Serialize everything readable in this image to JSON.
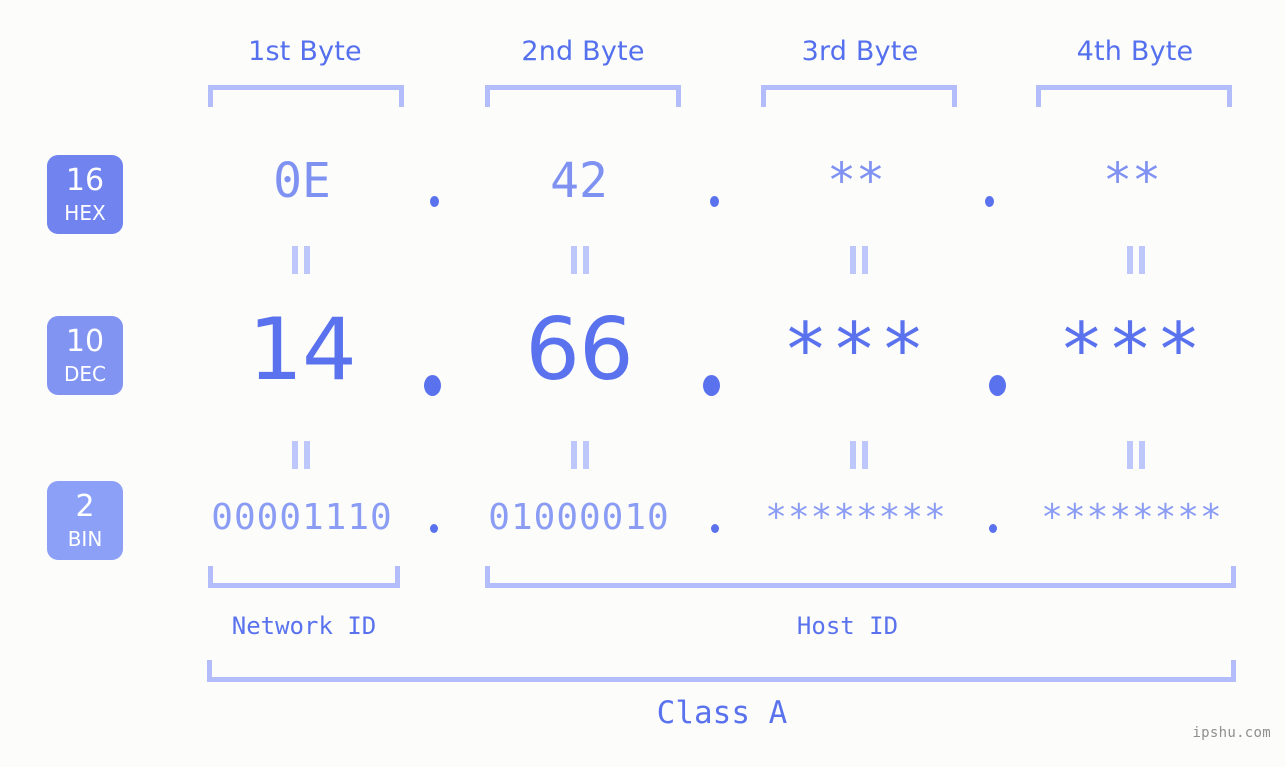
{
  "watermark": "ipshu.com",
  "bytes": [
    {
      "label": "1st Byte"
    },
    {
      "label": "2nd Byte"
    },
    {
      "label": "3rd Byte"
    },
    {
      "label": "4th Byte"
    }
  ],
  "rows": [
    {
      "base_number": "16",
      "base_name": "HEX",
      "values": [
        "0E",
        "42",
        "**",
        "**"
      ]
    },
    {
      "base_number": "10",
      "base_name": "DEC",
      "values": [
        "14",
        "66",
        "***",
        "***"
      ]
    },
    {
      "base_number": "2",
      "base_name": "BIN",
      "values": [
        "00001110",
        "01000010",
        "********",
        "********"
      ]
    }
  ],
  "separators": {
    "dot": ".",
    "equals": "||"
  },
  "segments": {
    "network_id": "Network ID",
    "host_id": "Host ID",
    "class_name": "Class A"
  },
  "colors": {
    "background": "#fcfdfa",
    "accent_strong": "#5a72ee",
    "accent_mid": "#7f92f2",
    "accent_light": "#b3bdfb",
    "badge_hex": "#7083ef",
    "badge_dec": "#8294f2",
    "badge_bin": "#8ba0f6",
    "watermark": "#8f8f8f"
  }
}
